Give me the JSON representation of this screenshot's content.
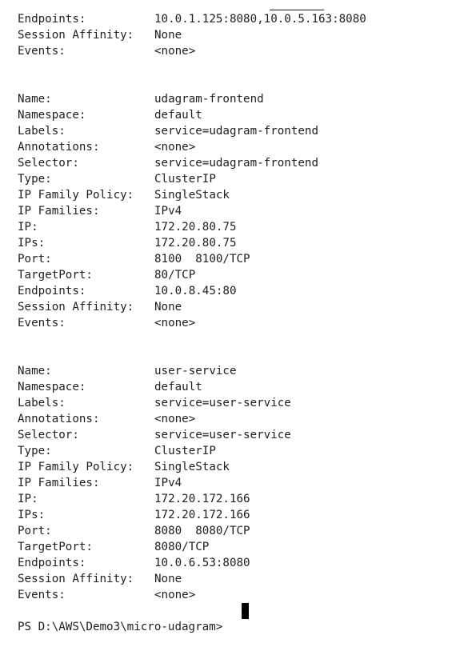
{
  "lines": [
    {
      "key": "Endpoints:",
      "value": "10.0.1.125:8080,10.0.5.163:8080"
    },
    {
      "key": "Session Affinity:",
      "value": "None"
    },
    {
      "key": "Events:",
      "value": "<none>"
    },
    {
      "key": "",
      "value": ""
    },
    {
      "key": "",
      "value": ""
    },
    {
      "key": "Name:",
      "value": "udagram-frontend"
    },
    {
      "key": "Namespace:",
      "value": "default"
    },
    {
      "key": "Labels:",
      "value": "service=udagram-frontend"
    },
    {
      "key": "Annotations:",
      "value": "<none>"
    },
    {
      "key": "Selector:",
      "value": "service=udagram-frontend"
    },
    {
      "key": "Type:",
      "value": "ClusterIP"
    },
    {
      "key": "IP Family Policy:",
      "value": "SingleStack"
    },
    {
      "key": "IP Families:",
      "value": "IPv4"
    },
    {
      "key": "IP:",
      "value": "172.20.80.75"
    },
    {
      "key": "IPs:",
      "value": "172.20.80.75"
    },
    {
      "key": "Port:",
      "value": "8100  8100/TCP"
    },
    {
      "key": "TargetPort:",
      "value": "80/TCP"
    },
    {
      "key": "Endpoints:",
      "value": "10.0.8.45:80"
    },
    {
      "key": "Session Affinity:",
      "value": "None"
    },
    {
      "key": "Events:",
      "value": "<none>"
    },
    {
      "key": "",
      "value": ""
    },
    {
      "key": "",
      "value": ""
    },
    {
      "key": "Name:",
      "value": "user-service"
    },
    {
      "key": "Namespace:",
      "value": "default"
    },
    {
      "key": "Labels:",
      "value": "service=user-service"
    },
    {
      "key": "Annotations:",
      "value": "<none>"
    },
    {
      "key": "Selector:",
      "value": "service=user-service"
    },
    {
      "key": "Type:",
      "value": "ClusterIP"
    },
    {
      "key": "IP Family Policy:",
      "value": "SingleStack"
    },
    {
      "key": "IP Families:",
      "value": "IPv4"
    },
    {
      "key": "IP:",
      "value": "172.20.172.166"
    },
    {
      "key": "IPs:",
      "value": "172.20.172.166"
    },
    {
      "key": "Port:",
      "value": "8080  8080/TCP"
    },
    {
      "key": "TargetPort:",
      "value": "8080/TCP"
    },
    {
      "key": "Endpoints:",
      "value": "10.0.6.53:8080"
    },
    {
      "key": "Session Affinity:",
      "value": "None"
    },
    {
      "key": "Events:",
      "value": "<none>"
    }
  ],
  "prompt": "PS D:\\AWS\\Demo3\\micro-udagram>",
  "colors": {
    "background": "#ffffff",
    "text": "#1e1e1e",
    "cursor": "#000000"
  }
}
